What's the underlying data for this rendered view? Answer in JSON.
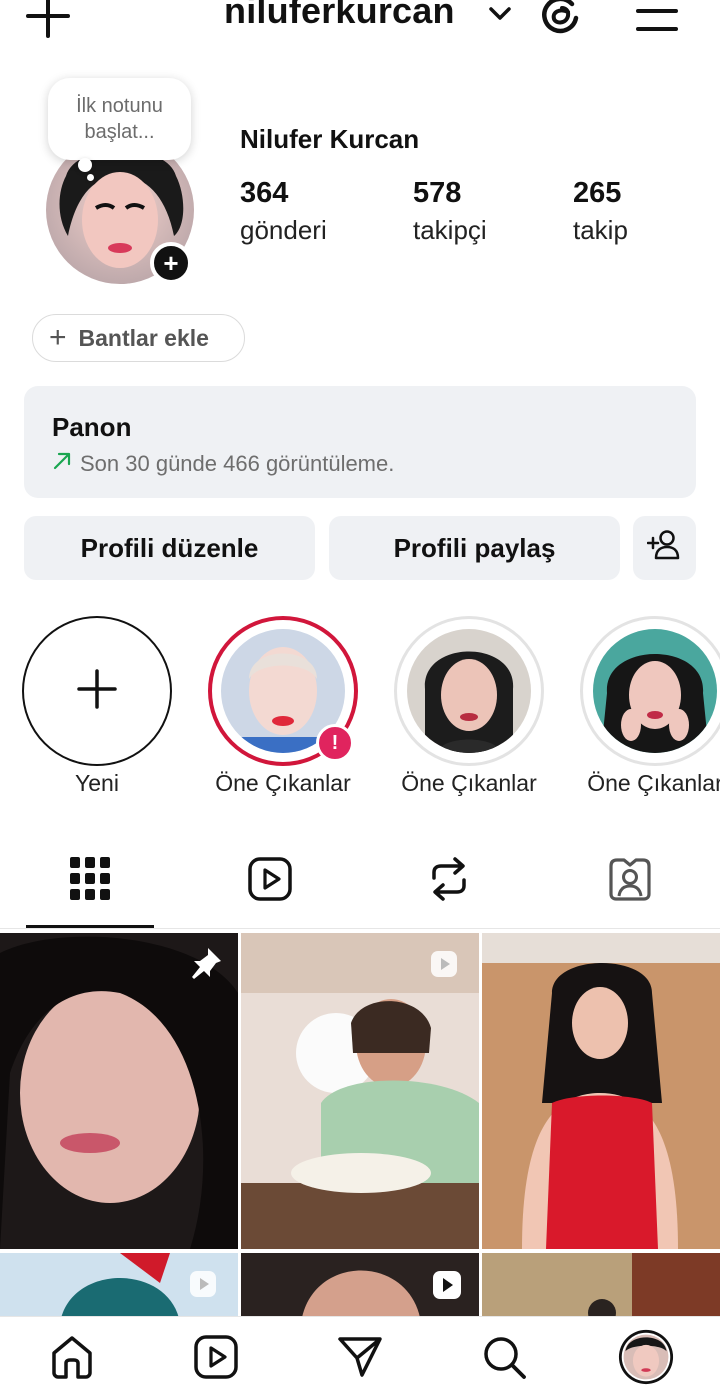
{
  "header": {
    "username": "niluferkurcan",
    "icons": [
      "plus-icon",
      "chevron-down-icon",
      "threads-icon",
      "menu-icon"
    ]
  },
  "profile": {
    "note_text": "İlk notunu başlat...",
    "full_name": "Nilufer Kurcan",
    "stats": [
      {
        "value": "364",
        "label": "gönderi"
      },
      {
        "value": "578",
        "label": "takipçi"
      },
      {
        "value": "265",
        "label": "takip"
      }
    ],
    "bands_label": "Bantlar ekle"
  },
  "dashboard": {
    "title": "Panon",
    "subtitle": "Son 30 günde 466 görüntüleme."
  },
  "actions": {
    "edit_label": "Profili düzenle",
    "share_label": "Profili paylaş",
    "add_person_icon": "add-person-icon"
  },
  "highlights": [
    {
      "label": "Yeni",
      "type": "new"
    },
    {
      "label": "Öne Çıkanlar",
      "type": "alert"
    },
    {
      "label": "Öne Çıkanlar",
      "type": "normal"
    },
    {
      "label": "Öne Çıkanlar",
      "type": "normal"
    }
  ],
  "tabs": [
    "grid-icon",
    "reels-icon",
    "reposts-icon",
    "tagged-icon"
  ],
  "colors": {
    "accent_red": "#e0245e",
    "story_ring": "#d1163b",
    "trend_green": "#1aa650",
    "panel_bg": "#eff1f4"
  },
  "bottom_nav": [
    "home-icon",
    "reels-icon",
    "messages-icon",
    "search-icon",
    "profile-avatar"
  ]
}
